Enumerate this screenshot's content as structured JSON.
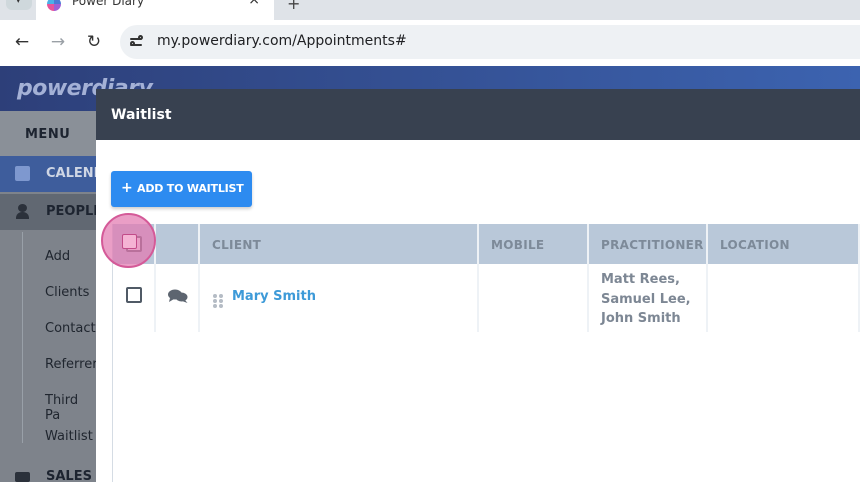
{
  "browser": {
    "tab_title": "Power Diary",
    "url": "my.powerdiary.com/Appointments#"
  },
  "app": {
    "logo": "powerdiary",
    "menu_label": "MENU",
    "nav": {
      "calendar": "CALEND",
      "people": "PEOPLE",
      "sales": "SALES"
    },
    "people_submenu": [
      "Add",
      "Clients",
      "Contacts",
      "Referrers",
      "Third Pa",
      "Waitlist"
    ]
  },
  "modal": {
    "title": "Waitlist",
    "add_button": "ADD TO WAITLIST",
    "columns": [
      "CLIENT",
      "MOBILE",
      "PRACTITIONER",
      "LOCATION"
    ],
    "rows": [
      {
        "client": "Mary Smith",
        "mobile": "",
        "practitioners": [
          "Matt Rees,",
          "Samuel Lee,",
          "John Smith"
        ],
        "location": ""
      }
    ]
  },
  "colors": {
    "header_gradient_start": "#2d3f79",
    "header_gradient_end": "#3c63b0",
    "modal_header": "#384150",
    "add_button": "#2d8bf0",
    "table_header": "#b9c8d9",
    "client_link": "#3d9ad8",
    "highlight": "#e279b0"
  }
}
